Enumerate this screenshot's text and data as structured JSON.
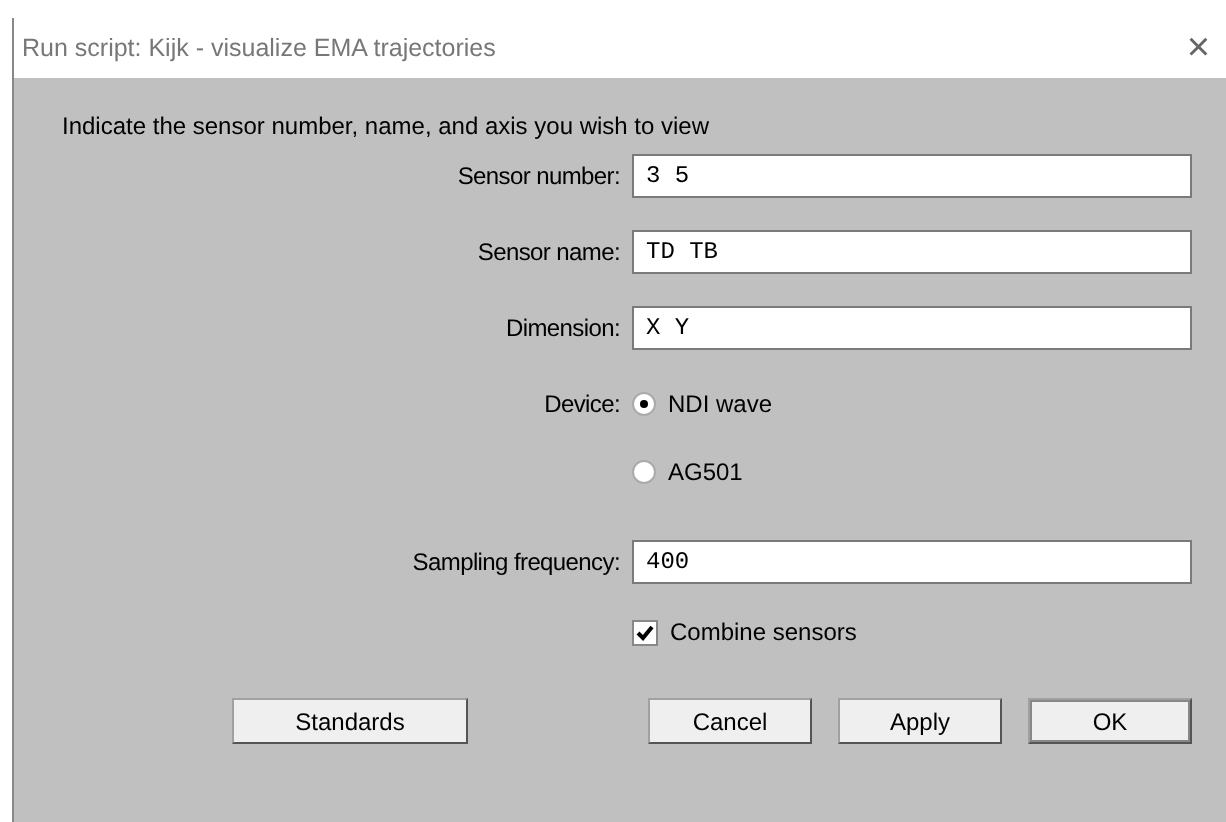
{
  "window": {
    "title": "Run script: Kijk - visualize EMA trajectories",
    "close": "×"
  },
  "instruction": "Indicate the sensor number, name, and axis you wish to view",
  "fields": [
    {
      "label": "Sensor number:",
      "value": "3 5"
    },
    {
      "label": "Sensor name:",
      "value": "TD TB"
    },
    {
      "label": "Dimension:",
      "value": "X Y"
    }
  ],
  "device": {
    "label": "Device:",
    "options": [
      {
        "label": "NDI wave",
        "selected": true
      },
      {
        "label": "AG501",
        "selected": false
      }
    ]
  },
  "sampling": {
    "label": "Sampling frequency:",
    "value": "400"
  },
  "combine": {
    "label": "Combine sensors",
    "checked": true
  },
  "buttons": [
    {
      "label": "Standards",
      "default": false
    },
    {
      "label": "Cancel",
      "default": false
    },
    {
      "label": "Apply",
      "default": false
    },
    {
      "label": "OK",
      "default": true
    }
  ]
}
